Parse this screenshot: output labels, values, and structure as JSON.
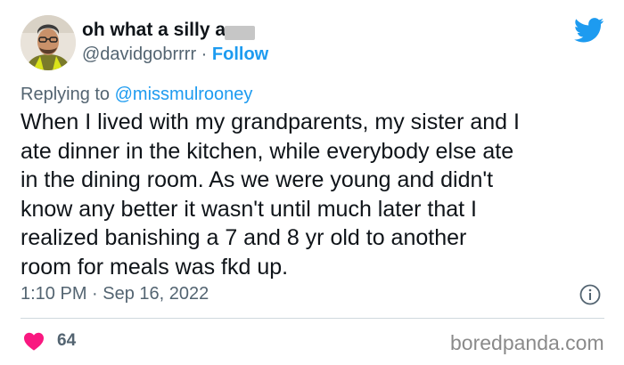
{
  "author": {
    "display_name": "oh what a silly a",
    "handle": "@davidgobrrrr",
    "separator": " · ",
    "follow_label": "Follow",
    "avatar_icon": "person-avatar"
  },
  "reply": {
    "prefix": "Replying to ",
    "handle": "@missmulrooney"
  },
  "tweet": {
    "text": "When I lived with my grandparents, my sister and I\nate dinner in the kitchen, while everybody else ate\nin the dining room. As we were young and didn't\nknow any better it wasn't until much later that I\nrealized banishing a 7 and 8 yr old to another\nroom for meals was fkd up.",
    "timestamp": "1:10 PM · Sep 16, 2022"
  },
  "actions": {
    "like_count": "64",
    "like_icon": "heart-icon",
    "info_icon": "info-icon"
  },
  "brand": {
    "logo_icon": "twitter-bird-icon",
    "watermark": "boredpanda.com",
    "accent_color": "#1d9bf0",
    "like_color": "#f91880"
  }
}
